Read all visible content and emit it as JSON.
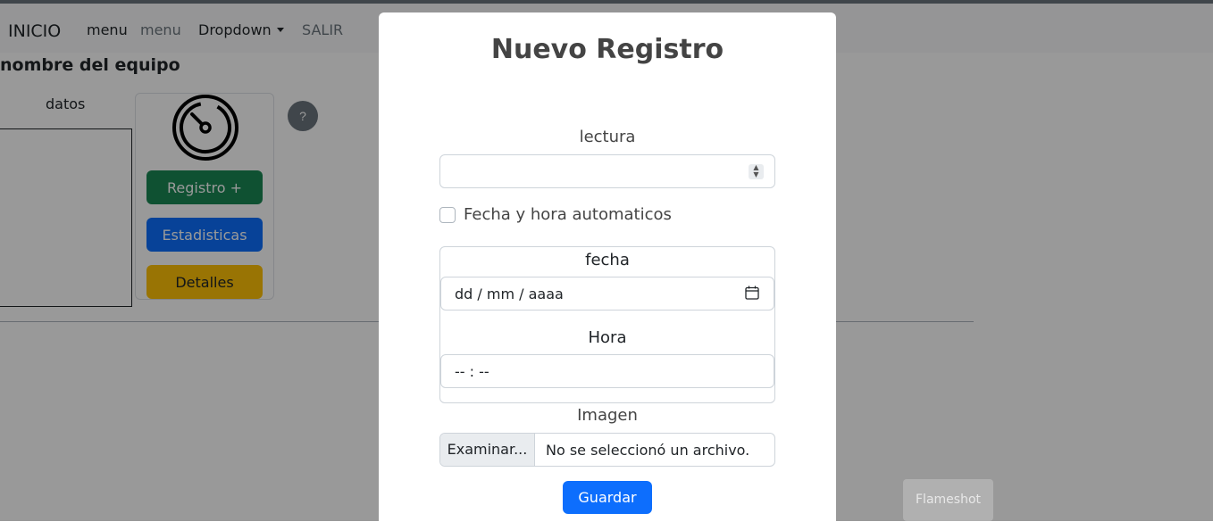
{
  "navbar": {
    "brand": "INICIO",
    "links": [
      "menu",
      "menu",
      "Dropdown",
      "SALIR"
    ]
  },
  "page": {
    "equipo_title": "nombre del equipo",
    "datos_label": "datos",
    "card": {
      "icon": "gauge-icon",
      "registro_label": "Registro +",
      "estadisticas_label": "Estadisticas",
      "detalles_label": "Detalles"
    },
    "help_label": "?"
  },
  "modal": {
    "title": "Nuevo Registro",
    "lectura_label": "lectura",
    "lectura_value": "",
    "auto_checkbox_label": "Fecha y hora automaticos",
    "auto_checked": false,
    "fecha_label": "fecha",
    "fecha_placeholder": "dd / mm / aaaa",
    "hora_label": "Hora",
    "hora_placeholder": "-- : --",
    "imagen_label": "Imagen",
    "file_button": "Examinar...",
    "file_status": "No se seleccionó un archivo.",
    "guardar_label": "Guardar"
  },
  "overlay": {
    "flameshot_label": "Flameshot"
  },
  "colors": {
    "success": "#198754",
    "primary": "#0d6efd",
    "warning": "#ffc107",
    "secondary": "#6c757d"
  }
}
